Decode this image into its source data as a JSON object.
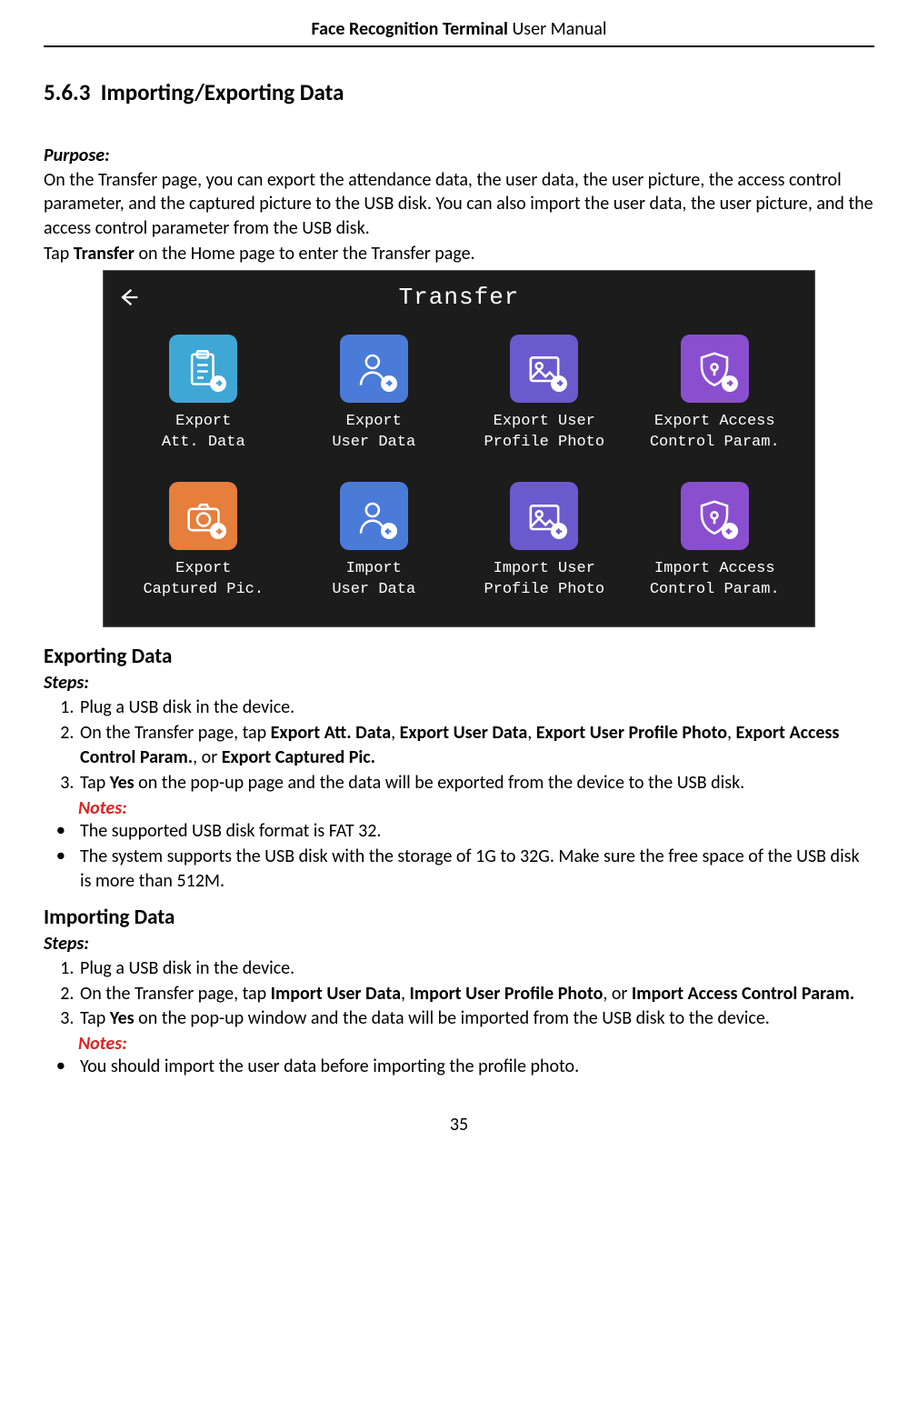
{
  "header": {
    "bold": "Face Recognition Terminal",
    "rest": "  User Manual"
  },
  "section": {
    "number": "5.6.3",
    "title": "Importing/Exporting Data"
  },
  "purpose": {
    "label": "Purpose:",
    "text": "On the Transfer page, you can export the attendance data, the user data, the user picture, the access control parameter, and the captured picture to the USB disk. You can also import the user data, the user picture, and the access control parameter from the USB disk.",
    "tap_prefix": "Tap ",
    "tap_bold": "Transfer",
    "tap_suffix": " on the Home page to enter the Transfer page."
  },
  "screenshot": {
    "title": "Transfer",
    "items": [
      {
        "label": "Export\nAtt. Data",
        "color": "#3fa7d6",
        "icon": "clipboard",
        "dir": "out"
      },
      {
        "label": "Export\nUser Data",
        "color": "#4a7bd8",
        "icon": "person",
        "dir": "out"
      },
      {
        "label": "Export User\nProfile Photo",
        "color": "#6a5acd",
        "icon": "photo",
        "dir": "out"
      },
      {
        "label": "Export Access\nControl Param.",
        "color": "#8a4fcf",
        "icon": "shield",
        "dir": "out"
      },
      {
        "label": "Export\nCaptured Pic.",
        "color": "#e67e3c",
        "icon": "camera",
        "dir": "out"
      },
      {
        "label": "Import\nUser Data",
        "color": "#4a7bd8",
        "icon": "person",
        "dir": "in"
      },
      {
        "label": "Import User\nProfile Photo",
        "color": "#6a5acd",
        "icon": "photo",
        "dir": "in"
      },
      {
        "label": "Import Access\nControl Param.",
        "color": "#8a4fcf",
        "icon": "shield",
        "dir": "in"
      }
    ]
  },
  "exporting": {
    "heading": "Exporting Data",
    "steps_label": "Steps:",
    "steps": [
      {
        "pre": "Plug a USB disk in the device."
      },
      {
        "pre": "On the Transfer page, tap ",
        "b1": "Export Att. Data",
        "s1": ", ",
        "b2": "Export User Data",
        "s2": ", ",
        "b3": "Export User Profile Photo",
        "s3": ", ",
        "b4": "Export Access Control Param.",
        "s4": ", or ",
        "b5": "Export Captured Pic."
      },
      {
        "pre": "Tap ",
        "b1": "Yes",
        "s1": " on the pop-up page and the data will be exported from the device to the USB disk."
      }
    ],
    "notes_label": "Notes:",
    "notes": [
      "The supported USB disk format is FAT 32.",
      "The system supports the USB disk with the storage of 1G to 32G. Make sure the free space of the USB disk is more than 512M."
    ]
  },
  "importing": {
    "heading": "Importing Data",
    "steps_label": "Steps:",
    "steps": [
      {
        "pre": "Plug a USB disk in the device."
      },
      {
        "pre": "On the Transfer page, tap ",
        "b1": "Import User Data",
        "s1": ", ",
        "b2": "Import User Profile Photo",
        "s2": ", or ",
        "b3": "Import Access Control Param."
      },
      {
        "pre": "Tap ",
        "b1": "Yes",
        "s1": " on the pop-up window and the data will be imported from the USB disk to the device."
      }
    ],
    "notes_label": "Notes:",
    "notes": [
      "You should import the user data before importing the profile photo."
    ]
  },
  "page_number": "35"
}
